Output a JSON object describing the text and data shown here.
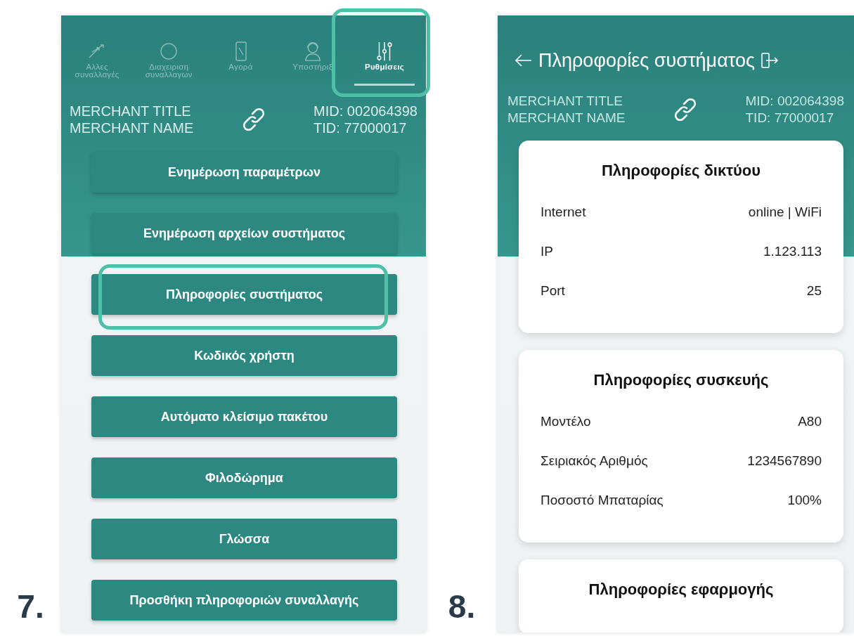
{
  "settings_screen": {
    "step": "7.",
    "tabs": [
      {
        "label": "Αλλες συναλλαγές",
        "selected": false,
        "highlighted": false
      },
      {
        "label": "Διαχειριση συναλλαγων",
        "selected": false,
        "highlighted": false
      },
      {
        "label": "Αγορά",
        "selected": false,
        "highlighted": false
      },
      {
        "label": "Υποστήριξ",
        "selected": false,
        "highlighted": false
      },
      {
        "label": "Ρυθμίσεις",
        "selected": true,
        "highlighted": true
      }
    ],
    "merchant": {
      "title": "MERCHANT TITLE",
      "name": "MERCHANT NAME",
      "mid": "MID: 002064398",
      "tid": "TID: 77000017"
    },
    "menu": [
      {
        "label": "Ενημέρωση παραμέτρων",
        "highlighted": false
      },
      {
        "label": "Ενημέρωση αρχείων συστήματος",
        "highlighted": false
      },
      {
        "label": "Πληροφορίες συστήματος",
        "highlighted": true
      },
      {
        "label": "Κωδικός χρήστη",
        "highlighted": false
      },
      {
        "label": "Αυτόματο κλείσιμο πακέτου",
        "highlighted": false
      },
      {
        "label": "Φιλοδώρημα",
        "highlighted": false
      },
      {
        "label": "Γλώσσα",
        "highlighted": false
      },
      {
        "label": "Προσθήκη πληροφοριών συναλλαγής",
        "highlighted": false
      }
    ]
  },
  "system_info_screen": {
    "step": "8.",
    "title": "Πληροφορίες συστήματος",
    "merchant": {
      "title": "MERCHANT TITLE",
      "name": "MERCHANT NAME",
      "mid": "MID: 002064398",
      "tid": "TID: 77000017"
    },
    "sections": [
      {
        "title": "Πληροφορίες δικτύου",
        "rows": [
          {
            "label": "Internet",
            "value": "online | WiFi"
          },
          {
            "label": "IP",
            "value": "1.123.113"
          },
          {
            "label": "Port",
            "value": "25"
          }
        ]
      },
      {
        "title": "Πληροφορίες συσκευής",
        "rows": [
          {
            "label": "Μοντέλο",
            "value": "A80"
          },
          {
            "label": "Σειριακός Αριθμός",
            "value": "1234567890"
          },
          {
            "label": "Ποσοστό Μπαταρίας",
            "value": "100%"
          }
        ]
      },
      {
        "title": "Πληροφορίες εφαρμογής"
      }
    ]
  }
}
